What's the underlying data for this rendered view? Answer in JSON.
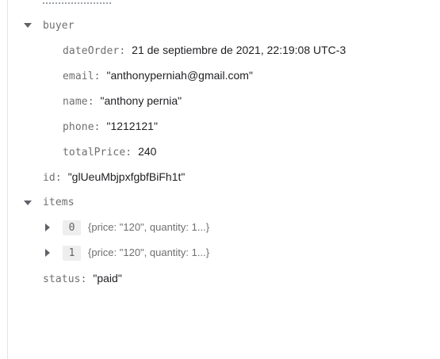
{
  "document": {
    "buyer": {
      "key": "buyer",
      "fields": {
        "dateOrder": {
          "key": "dateOrder",
          "colon": ":",
          "value": "21 de septiembre de 2021, 22:19:08 UTC-3"
        },
        "email": {
          "key": "email",
          "colon": ":",
          "value": "\"anthonyperniah@gmail.com\""
        },
        "name": {
          "key": "name",
          "colon": ":",
          "value": "\"anthony pernia\""
        },
        "phone": {
          "key": "phone",
          "colon": ":",
          "value": "\"1212121\""
        },
        "totalPrice": {
          "key": "totalPrice",
          "colon": ":",
          "value": "240"
        }
      }
    },
    "id": {
      "key": "id",
      "colon": ":",
      "value": "\"glUeuMbjpxfgbfBiFh1t\""
    },
    "items": {
      "key": "items",
      "entries": [
        {
          "index": "0",
          "preview": "{price: \"120\", quantity: 1...}"
        },
        {
          "index": "1",
          "preview": "{price: \"120\", quantity: 1...}"
        }
      ]
    },
    "status": {
      "key": "status",
      "colon": ":",
      "value": "\"paid\""
    }
  },
  "icons": {
    "expanded": "caret-down-icon",
    "collapsed": "caret-right-icon"
  },
  "colors": {
    "key": "#6f6f6f",
    "value": "#202124",
    "arrow": "#5f6368",
    "chip": "#eeeeee",
    "rule": "#e3e3e3"
  }
}
